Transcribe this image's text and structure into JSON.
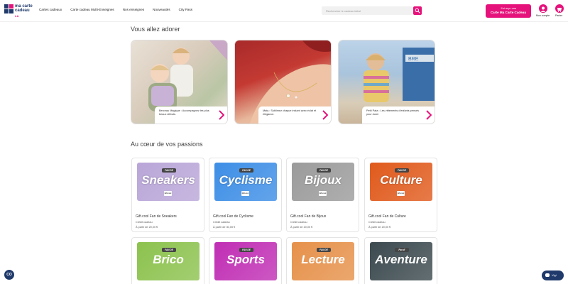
{
  "header": {
    "logo_line1": "ma carte",
    "logo_line2": "cadeau",
    "logo_sub": "LA",
    "nav": [
      "Cartes cadeaux",
      "Carte cadeau Multi-Enseignes",
      "Nos enseignes",
      "Nouveautés",
      "City Pass"
    ],
    "search_placeholder": "Rechercher le cadeau idéal",
    "cta_line1": "J'ai reçu une",
    "cta_line2": "Carte Ma Carte Cadeau",
    "account_label": "Mon compte",
    "cart_label": "Panier"
  },
  "sections": {
    "adorer_title": "Vous allez adorer",
    "passions_title": "Au cœur de vos passions"
  },
  "promos": [
    {
      "caption": "Berceau Magique : Accompagnez les plus beaux débuts."
    },
    {
      "caption": "Maty : Sublimez chaque instant avec éclat et élégance."
    },
    {
      "caption": "Petit Pata : Les vêtements d'enfants pensés pour durer"
    }
  ],
  "cards": [
    {
      "fan": "FAN DE",
      "word": "Sneakers",
      "name": "Gift.cool Fan de Sneakers",
      "type": "Crédit cadeau",
      "price": "À partir de 20,00 €",
      "color": "#b9a6d8"
    },
    {
      "fan": "FAN DE",
      "word": "Cyclisme",
      "name": "Gift.cool Fan de Cyclisme",
      "type": "Crédit cadeau",
      "price": "À partir de 30,00 €",
      "color": "#3d8ee6"
    },
    {
      "fan": "FAN DE",
      "word": "Bijoux",
      "name": "Gift.cool Fan de Bijoux",
      "type": "Crédit cadeau",
      "price": "À partir de 20,00 €",
      "color": "#9b9b9b"
    },
    {
      "fan": "FAN DE",
      "word": "Culture",
      "name": "Gift.cool Fan de Culture",
      "type": "Crédit cadeau",
      "price": "À partir de 20,00 €",
      "color": "#e05a1c"
    }
  ],
  "cards_row2": [
    {
      "fan": "FAN DE",
      "word": "Brico",
      "color": "#8cc24e"
    },
    {
      "fan": "FAN DE",
      "word": "Sports",
      "color": "#c02eb4"
    },
    {
      "fan": "FAN DE",
      "word": "Lecture",
      "color": "#e6914a"
    },
    {
      "fan": "Fan d'",
      "word": "Aventure",
      "color": "#3c4a4f"
    }
  ],
  "gift_badge": "Gift.cool",
  "cookie_label": "CO",
  "chat_label": "Vigi"
}
